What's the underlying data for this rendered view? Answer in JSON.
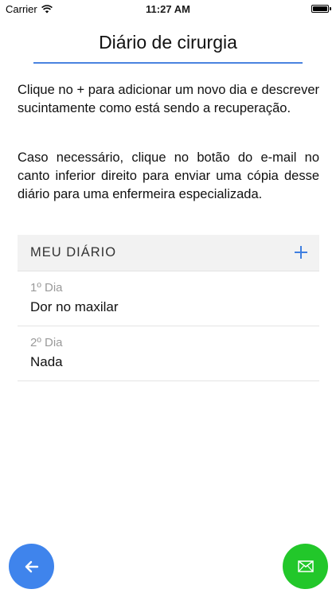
{
  "status_bar": {
    "carrier": "Carrier",
    "time": "11:27 AM"
  },
  "header": {
    "title": "Diário de cirurgia"
  },
  "instructions": {
    "paragraph_1": "Clique no + para adicionar um novo dia e descrever sucintamente como está sendo a recuperação.",
    "paragraph_2": "Caso necessário, clique no botão do e-mail no canto inferior direito para enviar uma cópia desse diário para uma enfermeira especializada."
  },
  "diary": {
    "title": "MEU DIÁRIO",
    "entries": [
      {
        "day": "1º Dia",
        "text": "Dor no maxilar"
      },
      {
        "day": "2º Dia",
        "text": "Nada"
      }
    ]
  },
  "icons": {
    "add": "plus-icon",
    "back": "arrow-left-icon",
    "email": "envelope-icon",
    "wifi": "wifi-icon",
    "battery": "battery-icon"
  },
  "colors": {
    "accent_blue": "#4a83e0",
    "back_button": "#3f84ec",
    "email_button": "#22c72a",
    "diary_header_bg": "#f2f2f2"
  }
}
